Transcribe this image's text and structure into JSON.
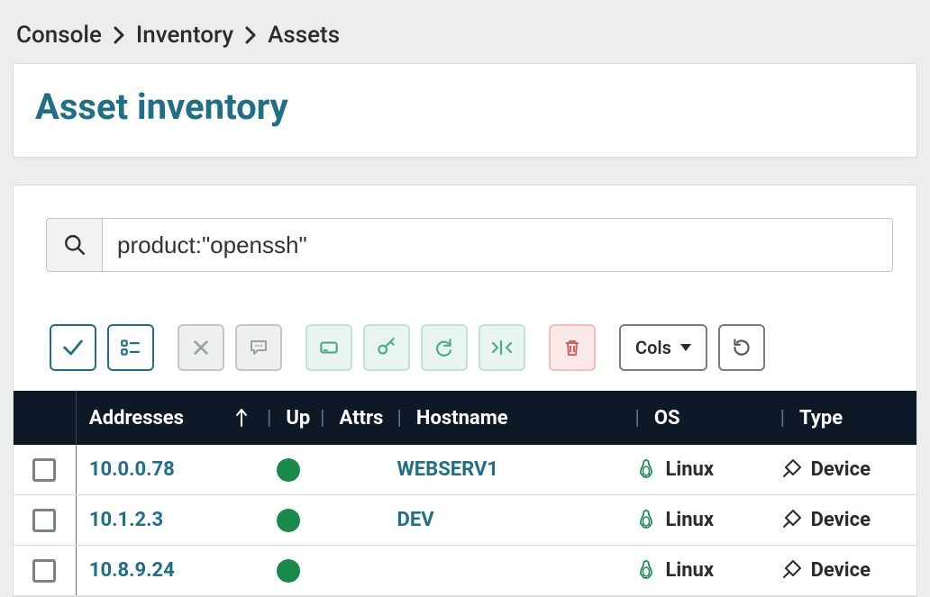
{
  "breadcrumb": {
    "0": "Console",
    "1": "Inventory",
    "2": "Assets"
  },
  "page": {
    "title": "Asset inventory"
  },
  "search": {
    "value": "product:\"openssh\""
  },
  "toolbar": {
    "cols_label": "Cols"
  },
  "table": {
    "headers": {
      "addresses": "Addresses",
      "up": "Up",
      "attrs": "Attrs",
      "hostname": "Hostname",
      "os": "OS",
      "type": "Type"
    },
    "rows": [
      {
        "address": "10.0.0.78",
        "up": true,
        "hostname": "WEBSERV1",
        "os": "Linux",
        "type": "Device"
      },
      {
        "address": "10.1.2.3",
        "up": true,
        "hostname": "DEV",
        "os": "Linux",
        "type": "Device"
      },
      {
        "address": "10.8.9.24",
        "up": true,
        "hostname": "",
        "os": "Linux",
        "type": "Device"
      }
    ]
  },
  "colors": {
    "teal": "#1f6f87",
    "headerBg": "#0e1826",
    "upGreen": "#178a4c"
  }
}
